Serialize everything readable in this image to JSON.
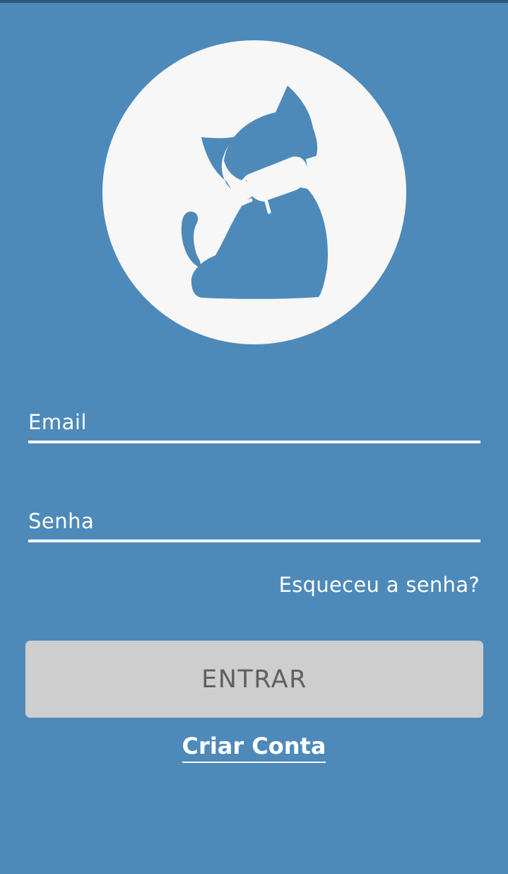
{
  "theme": {
    "background": "#4d8aba",
    "circle": "#f7f7f7",
    "button_bg": "#cecece",
    "button_text": "#606060",
    "text": "#ffffff"
  },
  "logo": {
    "icon": "cat-with-face-mask-icon"
  },
  "form": {
    "email_placeholder": "Email",
    "email_value": "",
    "password_placeholder": "Senha",
    "password_value": "",
    "forgot_password_label": "Esqueceu a senha?",
    "submit_label": "ENTRAR",
    "create_account_label": "Criar Conta"
  }
}
